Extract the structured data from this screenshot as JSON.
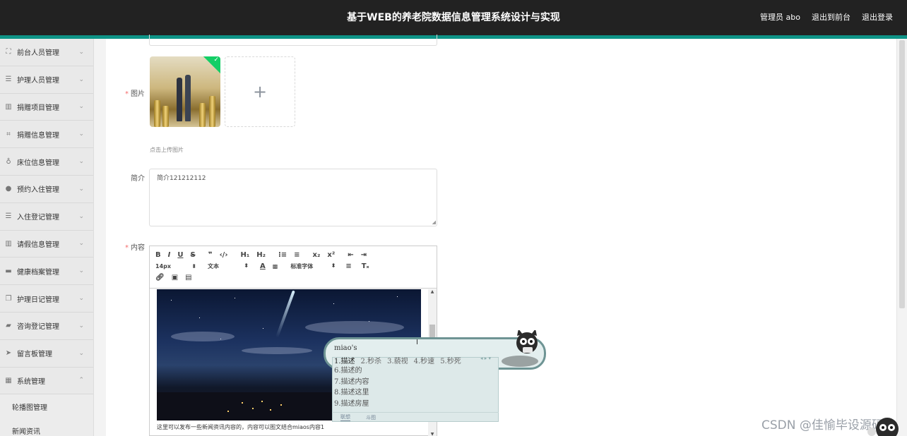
{
  "header": {
    "title": "基于WEB的养老院数据信息管理系统设计与实现",
    "user": "管理员 abo",
    "back_front": "退出到前台",
    "logout": "退出登录"
  },
  "sidebar": {
    "items": [
      {
        "label": "前台人员管理",
        "icon": "expand-icon"
      },
      {
        "label": "护理人员管理",
        "icon": "list-icon"
      },
      {
        "label": "捐赠项目管理",
        "icon": "bar-chart-icon"
      },
      {
        "label": "捐赠信息管理",
        "icon": "crop-icon"
      },
      {
        "label": "床位信息管理",
        "icon": "microphone-icon"
      },
      {
        "label": "预约入住管理",
        "icon": "user-icon"
      },
      {
        "label": "入住登记管理",
        "icon": "list-icon"
      },
      {
        "label": "请假信息管理",
        "icon": "bar-chart-icon"
      },
      {
        "label": "健康档案管理",
        "icon": "chat-icon"
      },
      {
        "label": "护理日记管理",
        "icon": "copy-icon"
      },
      {
        "label": "咨询登记管理",
        "icon": "folder-icon"
      },
      {
        "label": "留言板管理",
        "icon": "send-icon"
      },
      {
        "label": "系统管理",
        "icon": "grid-icon"
      }
    ],
    "sub_items": [
      "轮播图管理",
      "新闻资讯"
    ]
  },
  "form": {
    "image_label": "图片",
    "upload_hint": "点击上传图片",
    "intro_label": "简介",
    "intro_value": "简介121212112",
    "content_label": "内容",
    "add_symbol": "+"
  },
  "editor": {
    "font_size": "14px",
    "text_type": "文本",
    "font_family": "标准字体",
    "content_text": "这里可以发布一些新闻资讯内容的，内容可以图文结合miaos内容1"
  },
  "ime": {
    "input": "miao's",
    "candidates": [
      "1.描述",
      "2.秒杀",
      "3.藐视",
      "4.秒速",
      "5.秒死"
    ],
    "more": [
      "6.描述的",
      "7.描述内容",
      "8.描述这里",
      "9.描述房屋"
    ],
    "tabs": [
      "联想",
      "斗图"
    ]
  },
  "watermark": "CSDN @佳愉毕设源码"
}
